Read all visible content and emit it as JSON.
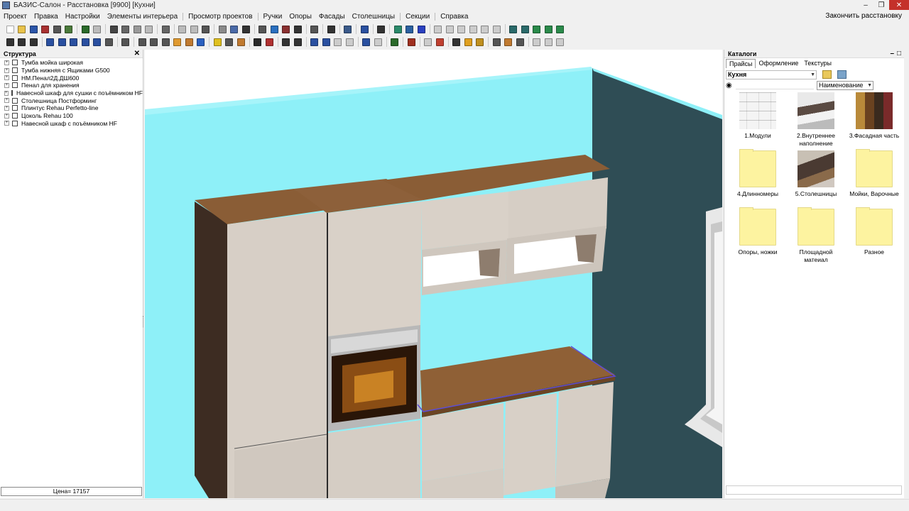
{
  "window": {
    "title": "БАЗИС-Салон - Расстановка [9900] [Кухни]"
  },
  "menu": {
    "items": [
      "Проект",
      "Правка",
      "Настройки",
      "Элементы интерьера",
      "Просмотр проектов",
      "Ручки",
      "Опоры",
      "Фасады",
      "Столешницы",
      "Секции",
      "Справка"
    ],
    "finish": "Закончить расстановку"
  },
  "structure": {
    "title": "Структура",
    "items": [
      "Тумба мойка широкая",
      "Тумба нижняя с Ящиками G500",
      "НМ.Пенал2Д.ДШ600",
      "Пенал для хранения",
      "Навесной шкаф для сушки с поъёмником HF",
      "Столешница Постформинг",
      "Плинтус Rehau Perfetto-line",
      "Цоколь Rehau 100",
      "Навесной шкаф с поъёмником HF"
    ],
    "price": "Цена= 17157"
  },
  "catalog": {
    "title": "Каталоги",
    "tabs": [
      "Прайсы",
      "Оформление",
      "Текстуры"
    ],
    "category": "Кухня",
    "sort": "Наименование",
    "search_value": "",
    "items": [
      {
        "label": "1.Модули",
        "type": "modules"
      },
      {
        "label": "2.Внутреннее наполнение",
        "type": "photo-drawer"
      },
      {
        "label": "3.Фасадная часть",
        "type": "swatches"
      },
      {
        "label": "4.Длинномеры",
        "type": "folder"
      },
      {
        "label": "5.Столешницы",
        "type": "photo-counter"
      },
      {
        "label": "Мойки, Варочные",
        "type": "folder"
      },
      {
        "label": "Опоры, ножки",
        "type": "folder"
      },
      {
        "label": "Площадной матеиал",
        "type": "folder"
      },
      {
        "label": "Разное",
        "type": "folder"
      }
    ]
  },
  "colors": {
    "wall_light": "#8ef0f8",
    "wall_dark": "#2f4d55",
    "facade": "#d7cfc6",
    "wood": "#8a5d36",
    "dark_side": "#3d2c22",
    "window_frame": "#e8e8e8"
  }
}
